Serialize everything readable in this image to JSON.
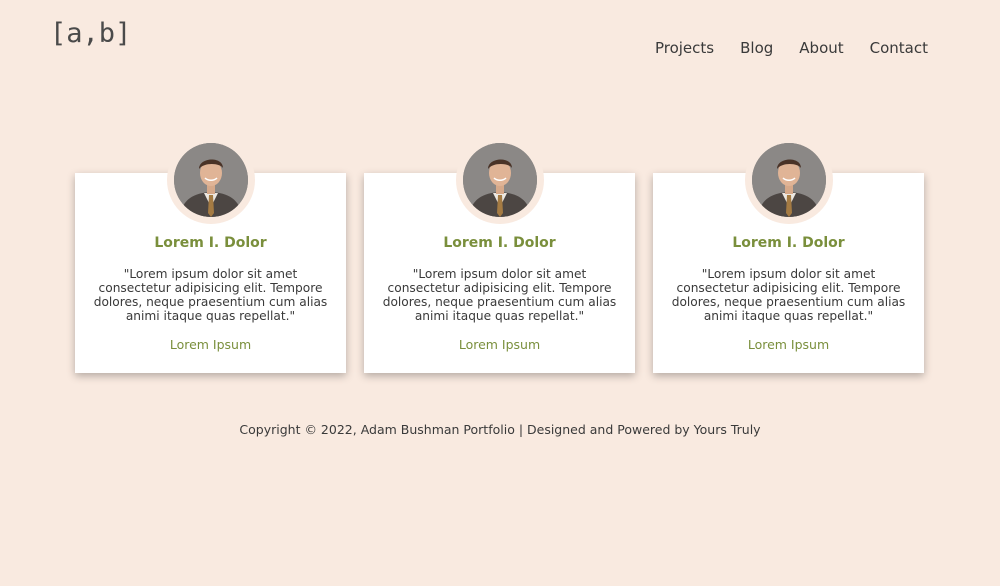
{
  "header": {
    "logo": "[a,b]",
    "nav": [
      "Projects",
      "Blog",
      "About",
      "Contact"
    ]
  },
  "cards": [
    {
      "name": "Lorem I. Dolor",
      "quote": "\"Lorem ipsum dolor sit amet consectetur adipisicing elit. Tempore dolores, neque praesentium cum alias animi itaque quas repellat.\"",
      "link": "Lorem Ipsum"
    },
    {
      "name": "Lorem I. Dolor",
      "quote": "\"Lorem ipsum dolor sit amet consectetur adipisicing elit. Tempore dolores, neque praesentium cum alias animi itaque quas repellat.\"",
      "link": "Lorem Ipsum"
    },
    {
      "name": "Lorem I. Dolor",
      "quote": "\"Lorem ipsum dolor sit amet consectetur adipisicing elit. Tempore dolores, neque praesentium cum alias animi itaque quas repellat.\"",
      "link": "Lorem Ipsum"
    }
  ],
  "footer": {
    "text": "Copyright © 2022, Adam Bushman Portfolio | Designed and Powered by Yours Truly"
  },
  "colors": {
    "background": "#f9eae0",
    "accent": "#7a8f3c",
    "card": "#ffffff",
    "text": "#3a3a3a"
  }
}
